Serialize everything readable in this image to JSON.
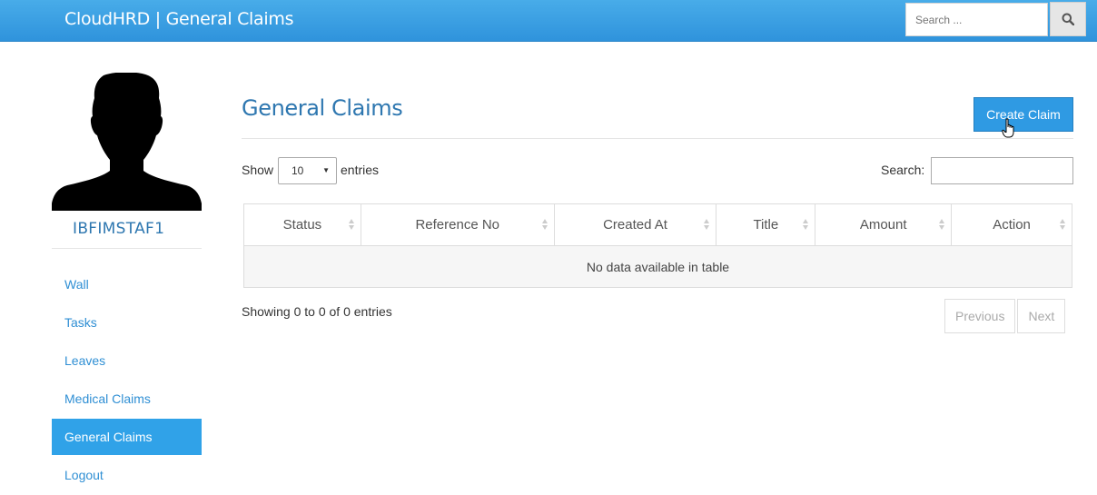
{
  "header": {
    "title": "CloudHRD | General Claims",
    "search_placeholder": "Search ...",
    "search_icon": "search-icon"
  },
  "sidebar": {
    "username": "IBFIMSTAF1",
    "items": [
      {
        "label": "Wall"
      },
      {
        "label": "Tasks"
      },
      {
        "label": "Leaves"
      },
      {
        "label": "Medical Claims"
      },
      {
        "label": "General Claims",
        "active": true
      },
      {
        "label": "Logout"
      }
    ]
  },
  "main": {
    "title": "General Claims",
    "create_button": "Create Claim",
    "show_label": "Show",
    "page_length": "10",
    "entries_label": "entries",
    "search_label": "Search:",
    "columns": [
      "Status",
      "Reference No",
      "Created At",
      "Title",
      "Amount",
      "Action"
    ],
    "empty_message": "No data available in table",
    "info": "Showing 0 to 0 of 0 entries",
    "pagination": {
      "previous": "Previous",
      "next": "Next"
    }
  },
  "colors": {
    "navbar": "#3aa0e4",
    "accent": "#2f9ae3",
    "title": "#2e77b0",
    "link": "#2f8fd4"
  }
}
